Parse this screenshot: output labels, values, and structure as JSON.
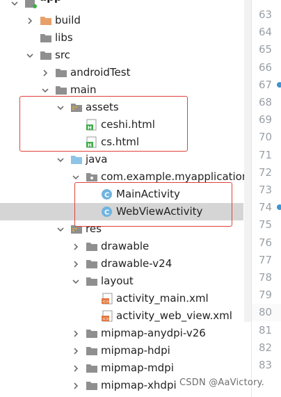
{
  "tree": {
    "rows": [
      {
        "label": "app",
        "arrow": "down",
        "icon": "module",
        "indent": 0
      },
      {
        "label": "build",
        "arrow": "right",
        "icon": "folder-orange",
        "indent": 1
      },
      {
        "label": "libs",
        "arrow": "none",
        "icon": "folder",
        "indent": 1
      },
      {
        "label": "src",
        "arrow": "down",
        "icon": "folder",
        "indent": 1
      },
      {
        "label": "androidTest",
        "arrow": "right",
        "icon": "folder",
        "indent": 2
      },
      {
        "label": "main",
        "arrow": "down",
        "icon": "folder",
        "indent": 2
      },
      {
        "label": "assets",
        "arrow": "down",
        "icon": "folder-res",
        "indent": 3
      },
      {
        "label": "ceshi.html",
        "arrow": "none",
        "icon": "html-file",
        "indent": 4
      },
      {
        "label": "cs.html",
        "arrow": "none",
        "icon": "html-file",
        "indent": 4
      },
      {
        "label": "java",
        "arrow": "down",
        "icon": "folder-blue",
        "indent": 3
      },
      {
        "label": "com.example.myapplication",
        "arrow": "down",
        "icon": "package",
        "indent": 4
      },
      {
        "label": "MainActivity",
        "arrow": "none",
        "icon": "class",
        "indent": 5
      },
      {
        "label": "WebViewActivity",
        "arrow": "none",
        "icon": "class",
        "indent": 5,
        "selected": true
      },
      {
        "label": "res",
        "arrow": "down",
        "icon": "folder-res",
        "indent": 3
      },
      {
        "label": "drawable",
        "arrow": "right",
        "icon": "folder",
        "indent": 4
      },
      {
        "label": "drawable-v24",
        "arrow": "right",
        "icon": "folder",
        "indent": 4
      },
      {
        "label": "layout",
        "arrow": "down",
        "icon": "folder",
        "indent": 4
      },
      {
        "label": "activity_main.xml",
        "arrow": "none",
        "icon": "xml-file",
        "indent": 5
      },
      {
        "label": "activity_web_view.xml",
        "arrow": "none",
        "icon": "xml-file",
        "indent": 5
      },
      {
        "label": "mipmap-anydpi-v26",
        "arrow": "right",
        "icon": "folder",
        "indent": 4
      },
      {
        "label": "mipmap-hdpi",
        "arrow": "right",
        "icon": "folder",
        "indent": 4
      },
      {
        "label": "mipmap-mdpi",
        "arrow": "right",
        "icon": "folder",
        "indent": 4
      },
      {
        "label": "mipmap-xhdpi",
        "arrow": "right",
        "icon": "folder",
        "indent": 4
      }
    ]
  },
  "gutter": {
    "line_numbers": [
      "63",
      "64",
      "65",
      "66",
      "67",
      "68",
      "69",
      "70",
      "71",
      "72",
      "73",
      "74",
      "75",
      "76",
      "77",
      "78",
      "79",
      "80",
      "81",
      "82",
      "83"
    ],
    "current_line": "80",
    "marker_lines": [
      "67",
      "74"
    ]
  },
  "watermark": "CSDN @AaVictory."
}
